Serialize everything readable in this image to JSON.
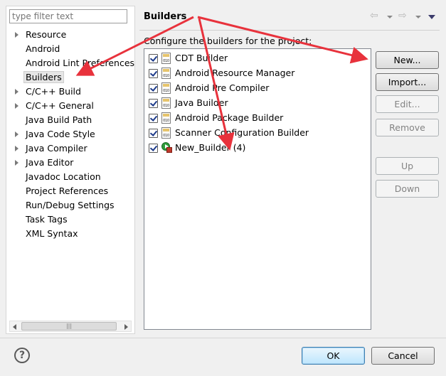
{
  "filter": {
    "placeholder": "type filter text"
  },
  "nav": {
    "items": [
      {
        "label": "Resource",
        "expandable": true
      },
      {
        "label": "Android",
        "expandable": false
      },
      {
        "label": "Android Lint Preferences",
        "expandable": false
      },
      {
        "label": "Builders",
        "expandable": false,
        "selected": true
      },
      {
        "label": "C/C++ Build",
        "expandable": true
      },
      {
        "label": "C/C++ General",
        "expandable": true
      },
      {
        "label": "Java Build Path",
        "expandable": false
      },
      {
        "label": "Java Code Style",
        "expandable": true
      },
      {
        "label": "Java Compiler",
        "expandable": true
      },
      {
        "label": "Java Editor",
        "expandable": true
      },
      {
        "label": "Javadoc Location",
        "expandable": false
      },
      {
        "label": "Project References",
        "expandable": false
      },
      {
        "label": "Run/Debug Settings",
        "expandable": false
      },
      {
        "label": "Task Tags",
        "expandable": false
      },
      {
        "label": "XML Syntax",
        "expandable": false
      }
    ]
  },
  "page": {
    "title": "Builders",
    "description": "Configure the builders for the project:"
  },
  "builders": [
    {
      "label": "CDT Builder",
      "checked": true,
      "icon": "builder-file-icon"
    },
    {
      "label": "Android Resource Manager",
      "checked": true,
      "icon": "builder-file-icon"
    },
    {
      "label": "Android Pre Compiler",
      "checked": true,
      "icon": "builder-file-icon"
    },
    {
      "label": "Java Builder",
      "checked": true,
      "icon": "builder-file-icon"
    },
    {
      "label": "Android Package Builder",
      "checked": true,
      "icon": "builder-file-icon"
    },
    {
      "label": "Scanner Configuration Builder",
      "checked": true,
      "icon": "builder-file-icon"
    },
    {
      "label": "New_Builder (4)",
      "checked": true,
      "icon": "external-tool-icon"
    }
  ],
  "buttons": {
    "new": "New...",
    "import": "Import...",
    "edit": "Edit...",
    "remove": "Remove",
    "up": "Up",
    "down": "Down",
    "ok": "OK",
    "cancel": "Cancel"
  },
  "colors": {
    "annotation_arrow": "#e8323c",
    "default_button_border": "#3c7fb1"
  }
}
